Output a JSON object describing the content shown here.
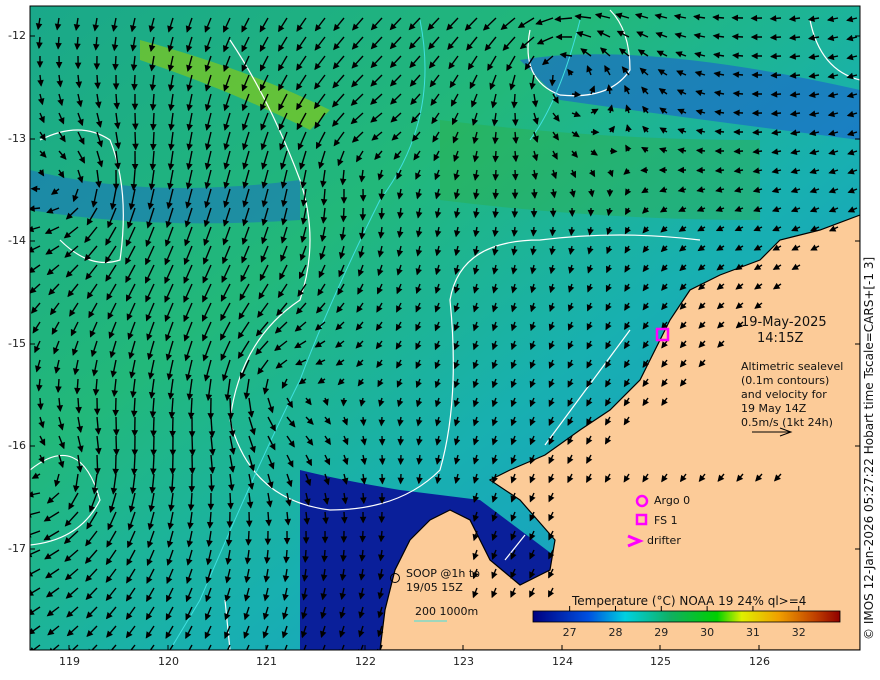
{
  "map": {
    "date": "19-May-2025",
    "time": "14:15Z",
    "description_lines": [
      "Altimetric sealevel",
      "(0.1m contours)",
      "and velocity for",
      "19 May 14Z",
      "0.5m/s (1kt 24h)"
    ],
    "legend": {
      "argo": "Argo 0",
      "fs": "FS 1",
      "drifter": "drifter",
      "soop_lines": [
        "SOOP @1h to",
        "19/05 15Z"
      ],
      "depth": "200  1000m"
    },
    "credit": "© IMOS 12-Jan-2026 05:27:22 Hobart time Tscale=CARS+[-1 3]",
    "lat_ticks": [
      "-12",
      "-13",
      "-14",
      "-15",
      "-16",
      "-17"
    ],
    "lon_ticks": [
      "119",
      "120",
      "121",
      "122",
      "123",
      "124",
      "125",
      "126"
    ],
    "colorbar": {
      "title": "Temperature (°C) NOAA 19 24% ql>=4",
      "ticks": [
        "27",
        "28",
        "29",
        "30",
        "31",
        "32"
      ],
      "range": [
        26.2,
        32.9
      ]
    },
    "colors": {
      "land": "#fccb98",
      "marker": "#ff00ff",
      "ocean_mid": "#1fb89a"
    }
  }
}
